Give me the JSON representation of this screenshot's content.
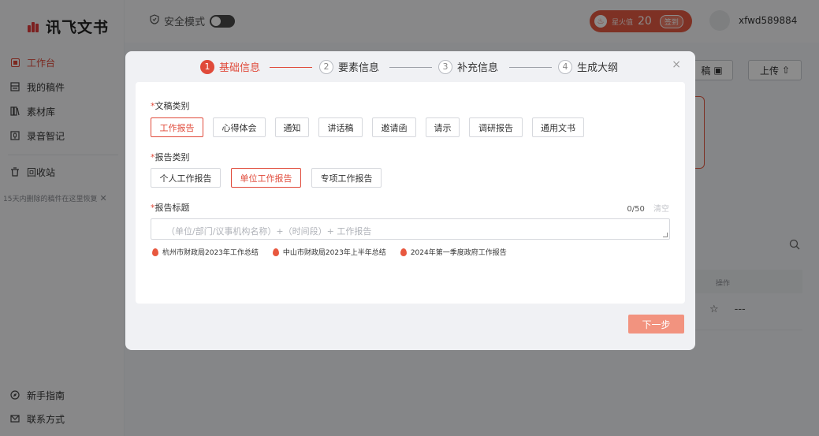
{
  "app": {
    "logo_text": "讯飞文书"
  },
  "sidebar": {
    "items": [
      {
        "label": "工作台",
        "icon": "dashboard-icon"
      },
      {
        "label": "我的稿件",
        "icon": "document-icon"
      },
      {
        "label": "素材库",
        "icon": "library-icon"
      },
      {
        "label": "录音智记",
        "icon": "recorder-icon"
      }
    ],
    "recycle": {
      "label": "回收站",
      "icon": "trash-icon"
    },
    "recover_hint": "15天内删除的稿件在这里恢复",
    "bottom_items": [
      {
        "label": "新手指南",
        "icon": "compass-icon"
      },
      {
        "label": "联系方式",
        "icon": "mail-icon"
      }
    ]
  },
  "header": {
    "safe_mode_label": "安全模式",
    "spark_label": "星火值",
    "spark_value": "20",
    "sign_in_label": "签到",
    "username": "xfwd589884"
  },
  "background": {
    "draft_button_label": "稿",
    "upload_button_label": "上传",
    "table_action_header": "操作",
    "row_more": "---"
  },
  "modal": {
    "steps": [
      {
        "num": "1",
        "label": "基础信息"
      },
      {
        "num": "2",
        "label": "要素信息"
      },
      {
        "num": "3",
        "label": "补充信息"
      },
      {
        "num": "4",
        "label": "生成大纲"
      }
    ],
    "close_symbol": "×",
    "doc_type": {
      "label": "文稿类别",
      "options": [
        "工作报告",
        "心得体会",
        "通知",
        "讲话稿",
        "邀请函",
        "请示",
        "调研报告",
        "通用文书"
      ],
      "selected": "工作报告"
    },
    "report_type": {
      "label": "报告类别",
      "options": [
        "个人工作报告",
        "单位工作报告",
        "专项工作报告"
      ],
      "selected": "单位工作报告"
    },
    "report_title": {
      "label": "报告标题",
      "counter": "0/50",
      "clear_label": "清空",
      "placeholder": "（单位/部门/议事机构名称）+（时间段）+ 工作报告",
      "examples": [
        "杭州市财政局2023年工作总结",
        "中山市财政局2023年上半年总结",
        "2024年第一季度政府工作报告"
      ]
    },
    "next_label": "下一步"
  }
}
